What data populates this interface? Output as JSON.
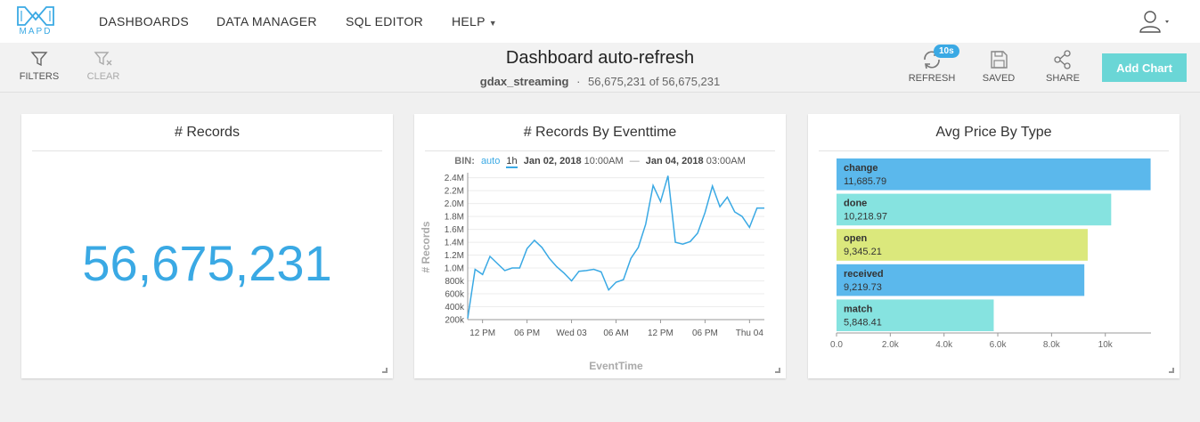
{
  "app": {
    "logo_text": "MAPD"
  },
  "nav": {
    "dashboards": "DASHBOARDS",
    "data_manager": "DATA MANAGER",
    "sql_editor": "SQL EDITOR",
    "help": "HELP"
  },
  "toolbar": {
    "filters": "FILTERS",
    "clear": "CLEAR",
    "title": "Dashboard auto-refresh",
    "table": "gdax_streaming",
    "separator": "·",
    "count": "56,675,231 of 56,675,231",
    "refresh_badge": "10s",
    "refresh": "REFRESH",
    "saved": "SAVED",
    "share": "SHARE",
    "add_chart": "Add Chart"
  },
  "colors": {
    "accent": "#3aa9e4",
    "teal": "#6ad6d6"
  },
  "cards": {
    "records": {
      "title": "# Records",
      "value": "56,675,231"
    },
    "timeline": {
      "title": "# Records By Eventtime",
      "bin_label": "BIN:",
      "bin_auto": "auto",
      "bin_unit": "1h",
      "range_start_date": "Jan 02, 2018",
      "range_start_time": "10:00AM",
      "range_sep": "—",
      "range_end_date": "Jan 04, 2018",
      "range_end_time": "03:00AM"
    },
    "avgprice": {
      "title": "Avg Price By Type"
    }
  },
  "chart_data": [
    {
      "type": "line",
      "title": "# Records By Eventtime",
      "xlabel": "EventTime",
      "ylabel": "# Records",
      "ylim": [
        200000,
        2450000
      ],
      "yticks": [
        200000,
        400000,
        600000,
        800000,
        1000000,
        1200000,
        1400000,
        1600000,
        1800000,
        2000000,
        2200000,
        2400000
      ],
      "ytick_labels": [
        "200k",
        "400k",
        "600k",
        "800k",
        "1.0M",
        "1.2M",
        "1.4M",
        "1.6M",
        "1.8M",
        "2.0M",
        "2.2M",
        "2.4M"
      ],
      "xtick_labels": [
        "12 PM",
        "06 PM",
        "Wed 03",
        "06 AM",
        "12 PM",
        "06 PM",
        "Thu 04"
      ],
      "xtick_hours": [
        2,
        8,
        14,
        20,
        26,
        32,
        38
      ],
      "x_hours": [
        0,
        1,
        2,
        3,
        4,
        5,
        6,
        7,
        8,
        9,
        10,
        11,
        12,
        13,
        14,
        15,
        16,
        17,
        18,
        19,
        20,
        21,
        22,
        23,
        24,
        25,
        26,
        27,
        28,
        29,
        30,
        31,
        32,
        33,
        34,
        35,
        36,
        37,
        38,
        39,
        40
      ],
      "series": [
        {
          "values": [
            220000,
            980000,
            900000,
            1180000,
            1070000,
            960000,
            1000000,
            1000000,
            1300000,
            1430000,
            1320000,
            1150000,
            1020000,
            920000,
            800000,
            950000,
            960000,
            980000,
            940000,
            660000,
            780000,
            820000,
            1150000,
            1320000,
            1680000,
            2280000,
            2030000,
            2430000,
            1400000,
            1370000,
            1410000,
            1540000,
            1860000,
            2270000,
            1950000,
            2100000,
            1870000,
            1800000,
            1630000,
            1930000,
            1930000
          ],
          "color": "#3aa9e4"
        }
      ]
    },
    {
      "type": "bar",
      "orientation": "horizontal",
      "title": "Avg Price By Type",
      "categories": [
        "change",
        "done",
        "open",
        "received",
        "match"
      ],
      "values": [
        11685.79,
        10218.97,
        9345.21,
        9219.73,
        5848.41
      ],
      "value_labels": [
        "11,685.79",
        "10,218.97",
        "9,345.21",
        "9,219.73",
        "5,848.41"
      ],
      "colors": [
        "#5bb8ec",
        "#86e3e0",
        "#dbe87c",
        "#5bb8ec",
        "#86e3e0"
      ],
      "xlim": [
        0,
        11700
      ],
      "xticks": [
        0,
        2000,
        4000,
        6000,
        8000,
        10000
      ],
      "xtick_labels": [
        "0.0",
        "2.0k",
        "4.0k",
        "6.0k",
        "8.0k",
        "10k"
      ]
    }
  ]
}
